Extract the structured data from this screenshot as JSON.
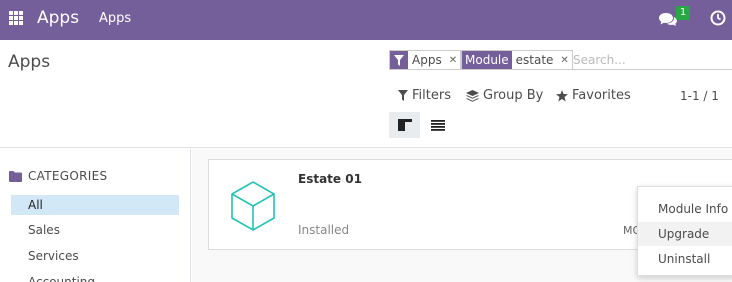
{
  "navbar": {
    "brand": "Apps",
    "menu_item": "Apps",
    "chat_count": "1",
    "accent_color": "#745f9a"
  },
  "control_panel": {
    "title": "Apps",
    "facets": {
      "apps": {
        "icon": "filter-icon",
        "value": "Apps"
      },
      "module": {
        "label": "Module",
        "value": "estate"
      }
    },
    "search_placeholder": "Search...",
    "filters_label": "Filters",
    "groupby_label": "Group By",
    "favorites_label": "Favorites",
    "pager": "1-1 / 1"
  },
  "sidebar": {
    "title": "CATEGORIES",
    "items": [
      {
        "label": "All",
        "active": true
      },
      {
        "label": "Sales"
      },
      {
        "label": "Services"
      },
      {
        "label": "Accounting"
      }
    ]
  },
  "card": {
    "name": "Estate 01",
    "status": "Installed",
    "truncated_button": "MO"
  },
  "dropdown": {
    "items": [
      "Module Info",
      "Upgrade",
      "Uninstall"
    ],
    "hovered": "Upgrade"
  }
}
